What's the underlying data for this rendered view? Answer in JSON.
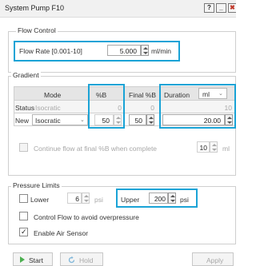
{
  "window": {
    "title": "System Pump F10",
    "help": "?",
    "minimize": "_",
    "close": "✖"
  },
  "flow_control": {
    "group_title": "Flow Control",
    "flow_rate_label": "Flow Rate [0.001-10]",
    "flow_rate_value": "5.000",
    "flow_rate_unit": "ml/min"
  },
  "gradient": {
    "group_title": "Gradient",
    "headers": {
      "mode": "Mode",
      "pct_b": "%B",
      "final_pct_b": "Final %B",
      "duration": "Duration",
      "duration_unit": "ml"
    },
    "status_row": {
      "label": "Status",
      "mode": "Isocratic",
      "pct_b": "0",
      "final_pct_b": "0",
      "duration": "10"
    },
    "new_row": {
      "label": "New",
      "mode": "Isocratic",
      "pct_b": "50",
      "final_pct_b": "50",
      "duration": "20.00"
    },
    "continue_label": "Continue flow at final %B when complete",
    "continue_value": "10",
    "continue_unit": "ml"
  },
  "pressure": {
    "group_title": "Pressure Limits",
    "lower_label": "Lower",
    "lower_value": "6",
    "lower_unit": "psi",
    "upper_label": "Upper",
    "upper_value": "200",
    "upper_unit": "psi",
    "control_flow_label": "Control Flow to avoid overpressure",
    "air_sensor_label": "Enable Air Sensor",
    "air_sensor_checked": "✓"
  },
  "buttons": {
    "start": "Start",
    "hold": "Hold",
    "apply": "Apply"
  },
  "colors": {
    "highlight": "#1aa3d6",
    "start_icon": "#4caf50"
  }
}
